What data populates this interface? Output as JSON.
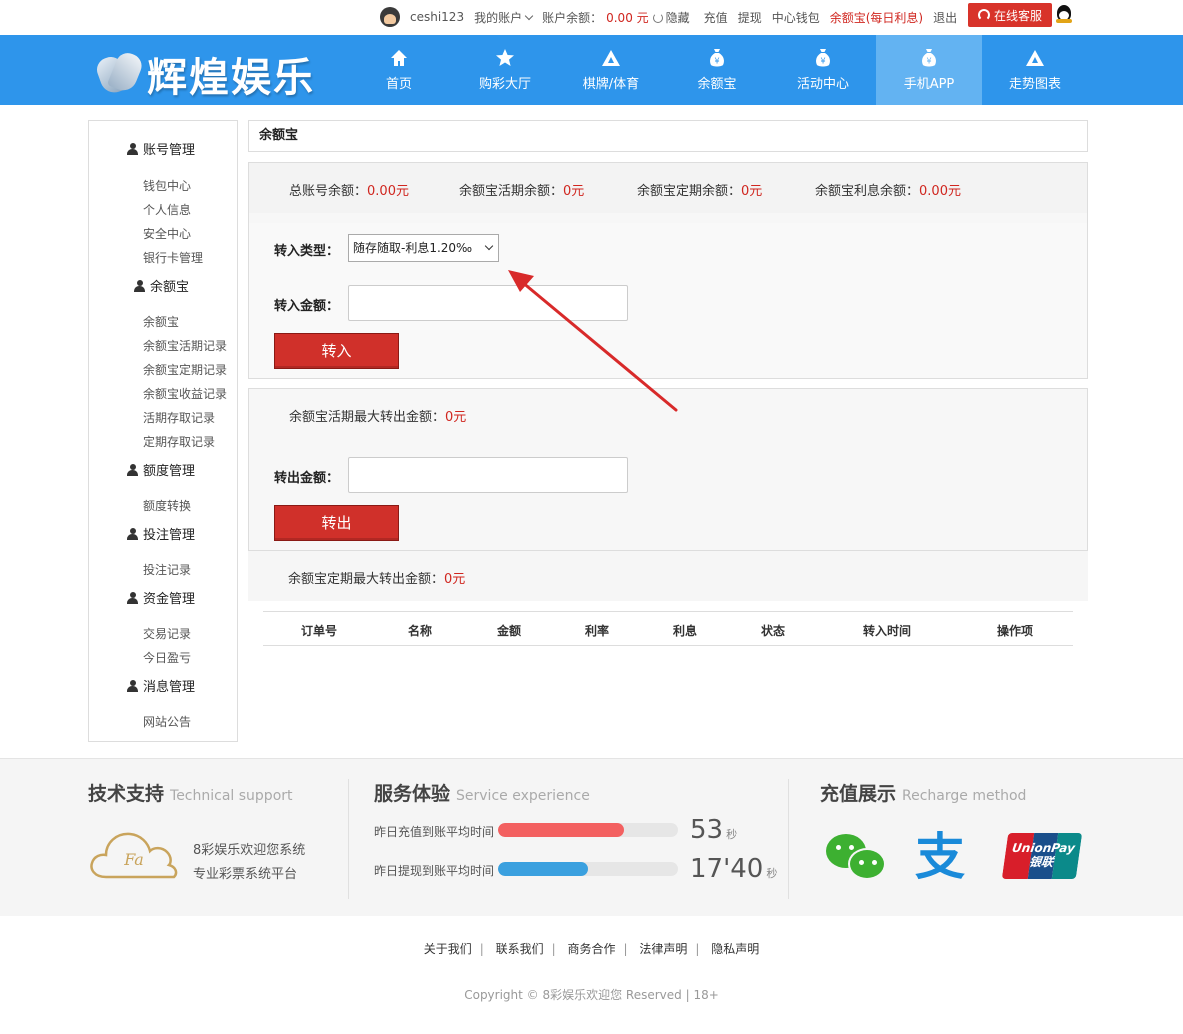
{
  "topbar": {
    "username": "ceshi123",
    "my_account": "我的账户",
    "balance_label": "账户余额：",
    "balance_value": "0.00 元",
    "hide": "隐藏",
    "recharge": "充值",
    "withdraw": "提现",
    "center_wallet": "中心钱包",
    "yuebao_daily": "余额宝(每日利息)",
    "logout": "退出",
    "online_service": "在线客服"
  },
  "header": {
    "logo_text": "辉煌娱乐",
    "nav": [
      {
        "label": "首页",
        "icon": "home-icon"
      },
      {
        "label": "购彩大厅",
        "icon": "star-icon"
      },
      {
        "label": "棋牌/体育",
        "icon": "triangle-icon"
      },
      {
        "label": "余额宝",
        "icon": "money-bag-icon"
      },
      {
        "label": "活动中心",
        "icon": "money-bag-icon"
      },
      {
        "label": "手机APP",
        "icon": "money-bag-icon",
        "active": true
      },
      {
        "label": "走势图表",
        "icon": "triangle-icon"
      }
    ]
  },
  "sidebar": {
    "groups": [
      {
        "label": "账号管理",
        "items": [
          "钱包中心",
          "个人信息",
          "安全中心",
          "银行卡管理"
        ]
      },
      {
        "label": "余额宝",
        "items": [
          "余额宝",
          "余额宝活期记录",
          "余额宝定期记录",
          "余额宝收益记录",
          "活期存取记录",
          "定期存取记录"
        ]
      },
      {
        "label": "额度管理",
        "items": [
          "额度转换"
        ]
      },
      {
        "label": "投注管理",
        "items": [
          "投注记录"
        ]
      },
      {
        "label": "资金管理",
        "items": [
          "交易记录",
          "今日盈亏"
        ]
      },
      {
        "label": "消息管理",
        "items": [
          "网站公告"
        ]
      }
    ]
  },
  "main": {
    "title": "余额宝",
    "stats": [
      {
        "label": "总账号余额：",
        "value": "0.00元"
      },
      {
        "label": "余额宝活期余额：",
        "value": "0元"
      },
      {
        "label": "余额宝定期余额：",
        "value": "0元"
      },
      {
        "label": "余额宝利息余额：",
        "value": "0.00元"
      }
    ],
    "transfer_in": {
      "type_label": "转入类型：",
      "type_selected": "随存随取-利息1.20‰",
      "amount_label": "转入金额：",
      "amount_value": "",
      "button": "转入"
    },
    "transfer_out": {
      "max_label": "余额宝活期最大转出金额：",
      "max_value": "0元",
      "amount_label": "转出金额：",
      "amount_value": "",
      "button": "转出"
    },
    "fixed_max": {
      "label": "余额宝定期最大转出金额：",
      "value": "0元"
    },
    "table_headers": [
      "订单号",
      "名称",
      "金额",
      "利率",
      "利息",
      "状态",
      "转入时间",
      "操作项"
    ]
  },
  "footer": {
    "tech": {
      "title": "技术支持",
      "subtitle": "Technical support",
      "line1": "8彩娱乐欢迎您系统",
      "line2": "专业彩票系统平台"
    },
    "service": {
      "title": "服务体验",
      "subtitle": "Service experience",
      "recharge_label": "昨日充值到账平均时间",
      "recharge_value": "53",
      "recharge_unit": "秒",
      "recharge_fill": 0.7,
      "withdraw_label": "昨日提现到账平均时间",
      "withdraw_value": "17'40",
      "withdraw_unit": "秒",
      "withdraw_fill": 0.5
    },
    "recharge": {
      "title": "充值展示",
      "subtitle": "Recharge method",
      "unionpay_text1": "UnionPay",
      "unionpay_text2": "银联"
    },
    "links": [
      "关于我们",
      "联系我们",
      "商务合作",
      "法律声明",
      "隐私声明"
    ],
    "copyright": "Copyright © 8彩娱乐欢迎您 Reserved | 18+"
  },
  "colors": {
    "brand_blue": "#2e95eb",
    "accent_red": "#d0302a",
    "bar_red": "#f36060",
    "bar_blue": "#3aa0df"
  }
}
